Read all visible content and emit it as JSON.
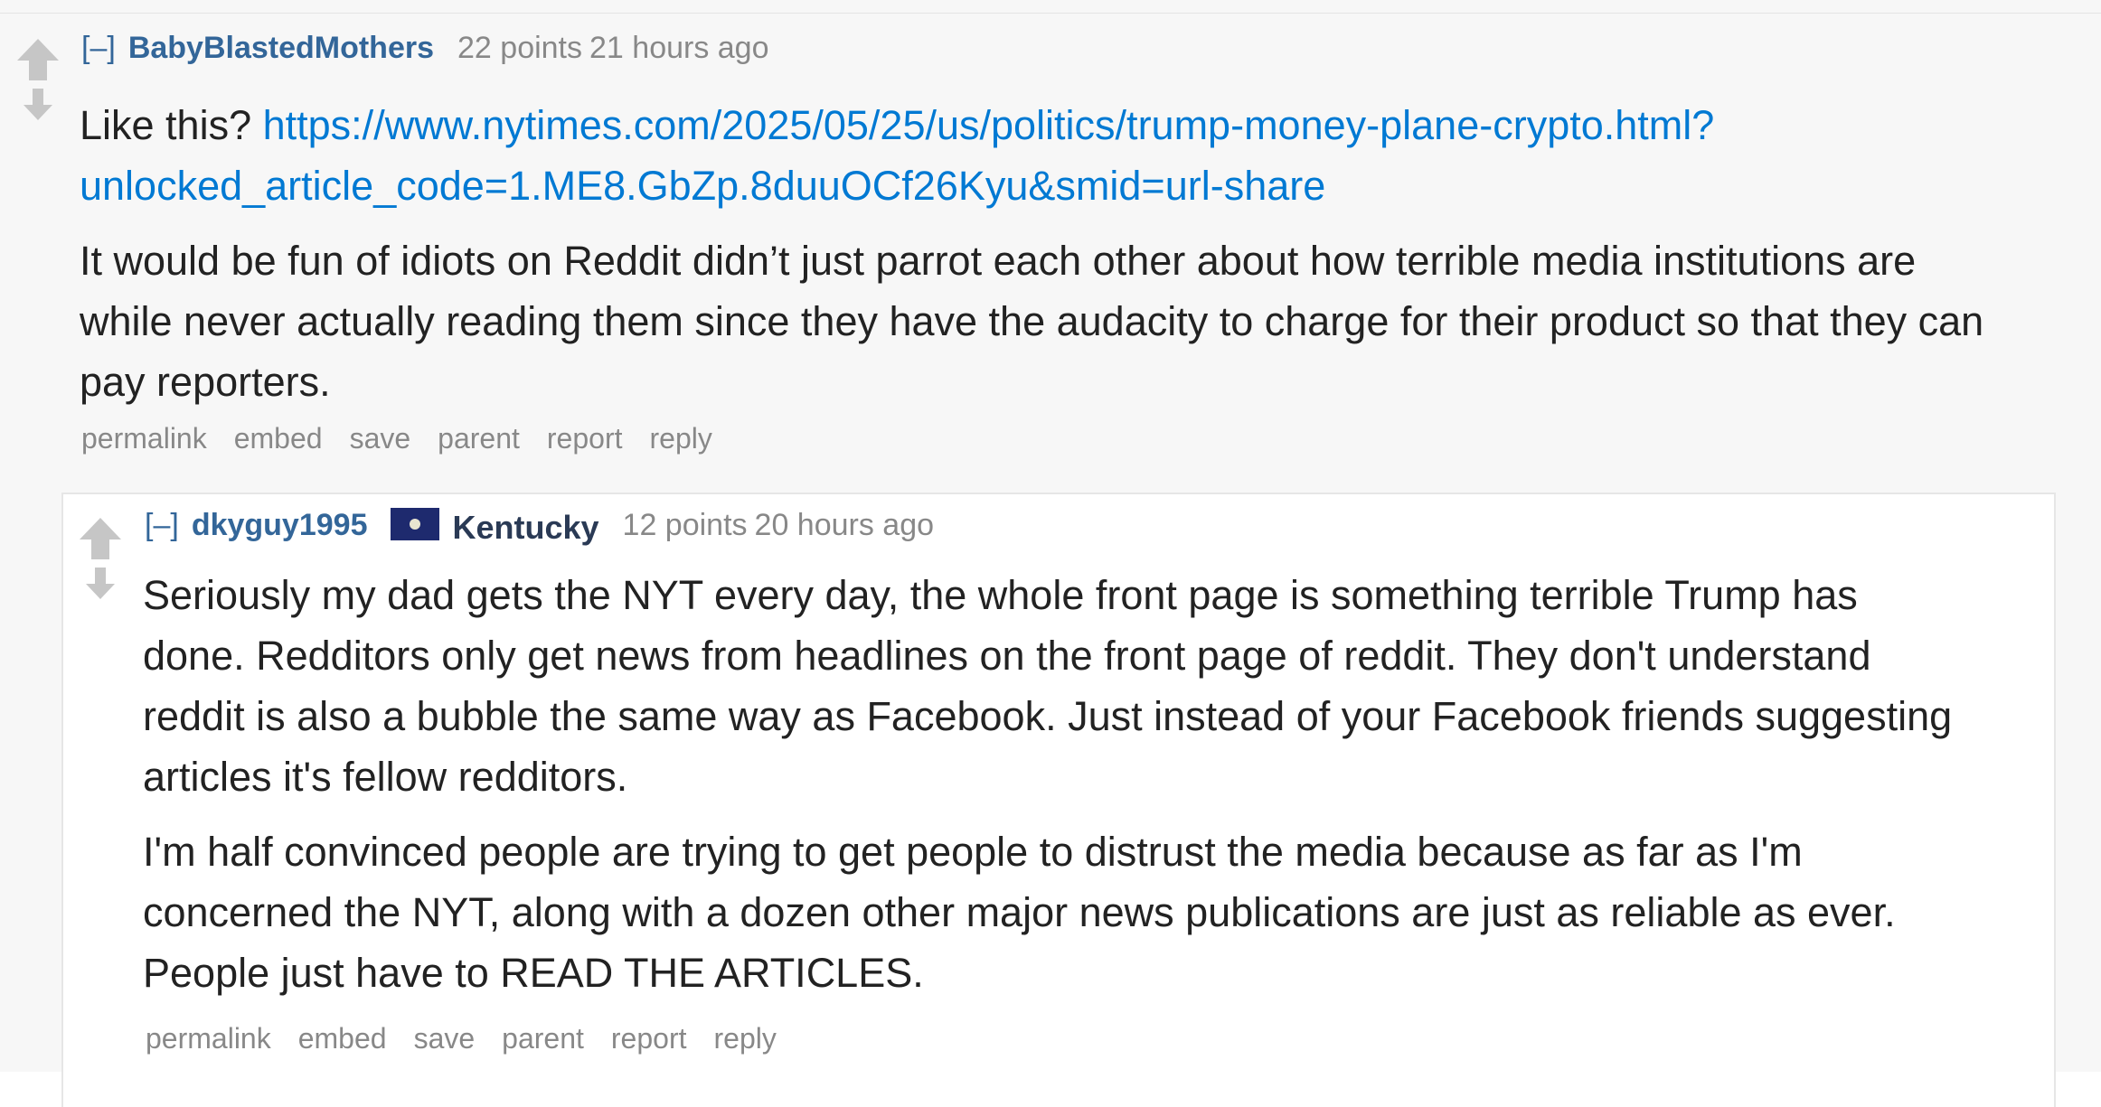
{
  "colors": {
    "page_background": "#f7f7f7",
    "child_background": "#ffffff",
    "author": "#336699",
    "link": "#0079d3",
    "meta_gray": "#888888",
    "body_text": "#222222",
    "flair_flag": "#1e2a6e"
  },
  "comments": [
    {
      "expand_label": "[–]",
      "author": "BabyBlastedMothers",
      "score": "22 points",
      "time": "21 hours ago",
      "upvote_icon": "up-arrow-icon",
      "downvote_icon": "down-arrow-icon",
      "body": {
        "p1_prefix": "Like this?",
        "p1_link_line1": "https://www.nytimes.com/2025/05/25/us/politics/trump-money-plane-crypto.html?",
        "p1_link_line2": "unlocked_article_code=1.ME8.GbZp.8duuOCf26Kyu&smid=url-share",
        "p2_line1": "It would be fun of idiots on Reddit didn’t just parrot each other about how terrible media institutions are",
        "p2_line2": "while never actually reading them since they have the audacity to charge for their product so that they can",
        "p2_line3": "pay reporters."
      },
      "actions": [
        "permalink",
        "embed",
        "save",
        "parent",
        "report",
        "reply"
      ]
    },
    {
      "expand_label": "[–]",
      "author": "dkyguy1995",
      "flair_icon": "kentucky-flag-icon",
      "flair_text": "Kentucky",
      "score": "12 points",
      "time": "20 hours ago",
      "upvote_icon": "up-arrow-icon",
      "downvote_icon": "down-arrow-icon",
      "body": {
        "p1_line1": "Seriously my dad gets the NYT every day, the whole front page is something terrible Trump has",
        "p1_line2": "done. Redditors only get news from headlines on the front page of reddit. They don't understand",
        "p1_line3": "reddit is also a bubble the same way as Facebook. Just instead of your Facebook friends suggesting",
        "p1_line4": "articles it's fellow redditors.",
        "p2_line1": "I'm half convinced people are trying to get people to distrust the media because as far as I'm",
        "p2_line2": "concerned the NYT, along with a dozen other major news publications are just as reliable as ever.",
        "p2_line3": "People just have to READ THE ARTICLES."
      },
      "actions": [
        "permalink",
        "embed",
        "save",
        "parent",
        "report",
        "reply"
      ]
    }
  ]
}
